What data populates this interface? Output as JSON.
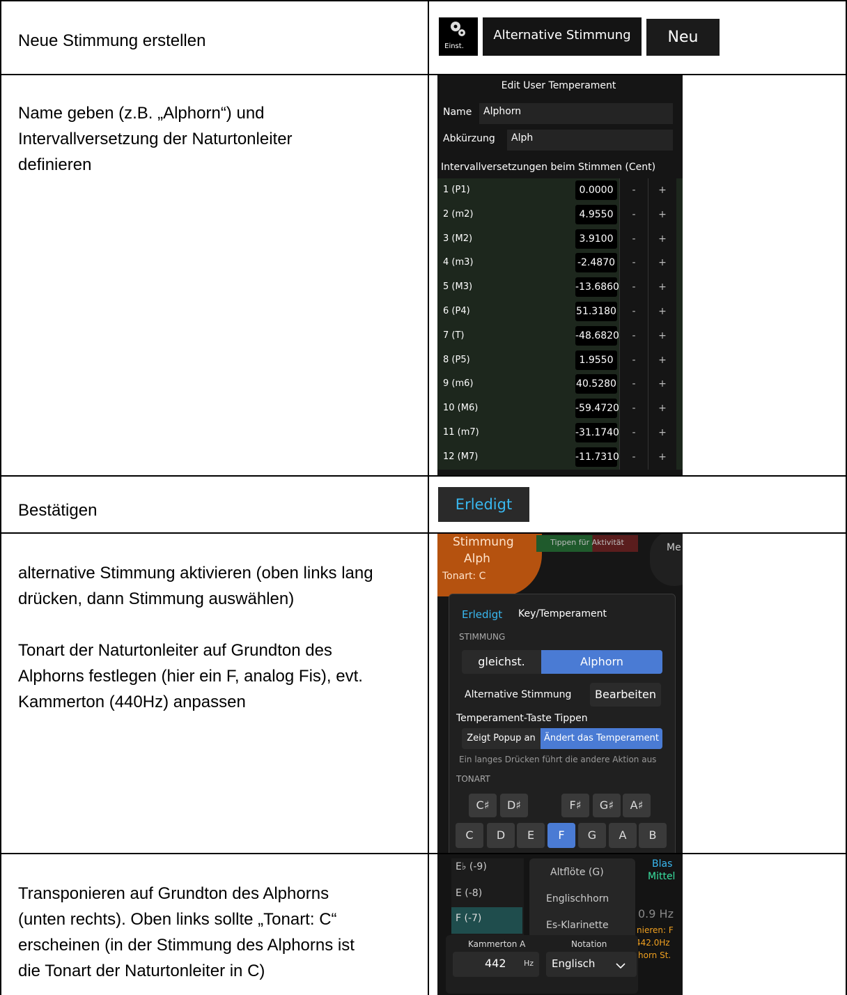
{
  "rows": [
    {
      "text": "Neue Stimmung erstellen"
    },
    {
      "text_lines": [
        "Name geben (z.B. „Alphorn“)  und",
        "Intervallversetzung der Naturtonleiter",
        "definieren"
      ]
    },
    {
      "text": "Bestätigen"
    },
    {
      "text_lines": [
        "alternative Stimmung aktivieren (oben links lang",
        "drücken, dann Stimmung auswählen)",
        "",
        "Tonart der Naturtonleiter auf Grundton des",
        "Alphorns festlegen (hier ein F, analog Fis), evt.",
        "Kammerton (440Hz) anpassen"
      ]
    },
    {
      "text_lines": [
        "Transponieren auf Grundton des Alphorns",
        "(unten rechts). Oben links sollte „Tonart: C“",
        "erscheinen (in der Stimmung des Alphorns ist",
        "die Tonart der Naturtonleiter in C)"
      ]
    }
  ],
  "toolbar": {
    "settings_label": "Einst.",
    "alt_label": "Alternative Stimmung",
    "new_label": "Neu"
  },
  "editor": {
    "title": "Edit User Temperament",
    "name_label": "Name",
    "name_value": "Alphorn",
    "abbr_label": "Abkürzung",
    "abbr_value": "Alph",
    "section": "Intervallversetzungen beim Stimmen (Cent)",
    "minus": "-",
    "plus": "+",
    "intervals": [
      {
        "label": "1 (P1)",
        "value": "0.0000"
      },
      {
        "label": "2 (m2)",
        "value": "4.9550"
      },
      {
        "label": "3 (M2)",
        "value": "3.9100"
      },
      {
        "label": "4 (m3)",
        "value": "-2.4870"
      },
      {
        "label": "5 (M3)",
        "value": "-13.6860"
      },
      {
        "label": "6 (P4)",
        "value": "51.3180"
      },
      {
        "label": "7 (T)",
        "value": "-48.6820"
      },
      {
        "label": "8 (P5)",
        "value": "1.9550"
      },
      {
        "label": "9 (m6)",
        "value": "40.5280"
      },
      {
        "label": "10 (M6)",
        "value": "-59.4720"
      },
      {
        "label": "11 (m7)",
        "value": "-31.1740"
      },
      {
        "label": "12 (M7)",
        "value": "-11.7310"
      }
    ]
  },
  "done": {
    "label": "Erledigt"
  },
  "popup": {
    "stimmung": "Stimmung",
    "abbr": "Alph",
    "tonart": "Tonart: C",
    "tap_hint": "Tippen für Aktivität",
    "me": "Me",
    "done": "Erledigt",
    "header": "Key/Temperament",
    "section_stimmung": "STIMMUNG",
    "seg_equal": "gleichst.",
    "seg_alphorn": "Alphorn",
    "alt_label": "Alternative Stimmung",
    "edit": "Bearbeiten",
    "tap_label": "Temperament-Taste Tippen",
    "tap_popup": "Zeigt Popup an",
    "tap_change": "Ändert das Temperament",
    "longpress": "Ein langes Drücken führt die andere Aktion aus",
    "section_tonart": "TONART",
    "sharps": [
      "C♯",
      "D♯",
      "F♯",
      "G♯",
      "A♯"
    ],
    "naturals": [
      "C",
      "D",
      "E",
      "F",
      "G",
      "A",
      "B"
    ],
    "selected_key": "F"
  },
  "transpose": {
    "items": [
      "E♭ (-9)",
      "E (-8)",
      "F (-7)"
    ],
    "selected": "F (-7)",
    "instruments": [
      "Altflöte (G)",
      "Englischhorn",
      "Es-Klarinette"
    ],
    "blas": "Blas",
    "mittel": "Mittel",
    "hz": "0.9 Hz",
    "nieren": "nieren: F",
    "hz2": "442.0Hz",
    "horn": "horn St.",
    "kammerton_label": "Kammerton A",
    "kammerton_value": "442",
    "kammerton_unit": "Hz",
    "notation_label": "Notation",
    "notation_value": "Englisch"
  },
  "colors": {
    "accent": "#4a7bd4",
    "cyan": "#39b8f0",
    "orange": "#b5520f",
    "green": "#1f4d34"
  }
}
